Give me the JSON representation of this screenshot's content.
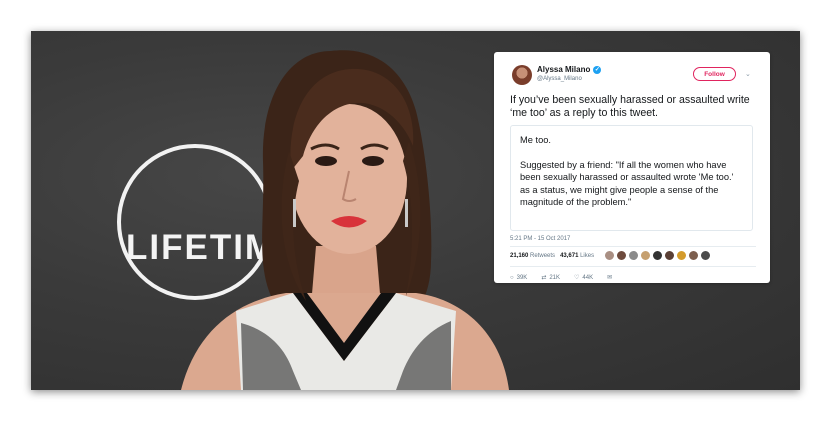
{
  "background_logo": {
    "text": "LIFETIM"
  },
  "tweet": {
    "author_name": "Alyssa Milano",
    "author_handle": "@Alyssa_Milano",
    "follow_label": "Follow",
    "text": "If you’ve been sexually harassed or assaulted write ‘me too’ as a reply to this tweet.",
    "quote_line1": "Me too.",
    "quote_line2": "Suggested by a friend: \"If all the women who have been sexually harassed or assaulted wrote 'Me too.' as a status, we might give people a sense of the magnitude of the problem.\"",
    "timestamp": "5:21 PM - 15 Oct 2017",
    "retweets_count": "21,160",
    "retweets_label": "Retweets",
    "likes_count": "43,671",
    "likes_label": "Likes",
    "reply_count": "39K",
    "retweet_action_count": "21K",
    "like_action_count": "44K"
  },
  "colors": {
    "follow_accent": "#e0245e",
    "verified_blue": "#1da1f2"
  }
}
